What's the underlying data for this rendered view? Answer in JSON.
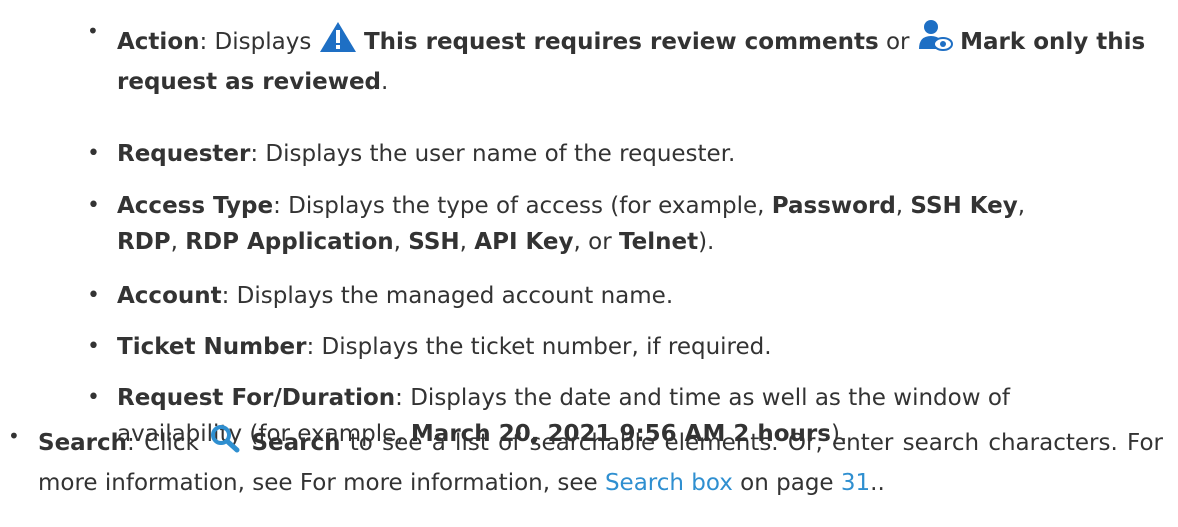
{
  "items": {
    "action": {
      "term": "Action",
      "sep": ": Displays ",
      "warning_text": "This request requires review comments",
      "or": " or ",
      "mark_text": "Mark only this request as reviewed",
      "end": ".",
      "warning_icon": "warning-triangle-icon",
      "mark_icon": "user-reviewed-icon"
    },
    "requester": {
      "term": "Requester",
      "desc": ": Displays the user name of the requester."
    },
    "access_type": {
      "term": "Access Type",
      "desc1": ": Displays the type of access (for example, ",
      "password": "Password",
      "c1": ", ",
      "ssh_key": "SSH Key",
      "c2": ",",
      "rdp": "RDP",
      "c3": ", ",
      "rdp_app": "RDP Application",
      "c4": ", ",
      "ssh": "SSH",
      "c5": ", ",
      "api_key": "API Key",
      "c6": ", or ",
      "telnet": "Telnet",
      "end": ")."
    },
    "account": {
      "term": "Account",
      "desc": ": Displays the managed account name."
    },
    "ticket": {
      "term": "Ticket Number",
      "desc": ": Displays the ticket number, if required."
    },
    "request_for": {
      "term": "Request For/Duration",
      "desc1": ": Displays the date and time as well as the window of availability (for example, ",
      "example": "March 20, 2021 9:56 AM 2 hours",
      "end": ")."
    },
    "search": {
      "term": "Search",
      "desc1": ": Click ",
      "search_label": "Search",
      "desc2": " to see a list of searchable elements. Or, enter search characters. For more information, see For more information, see ",
      "link_text": "Search box",
      "on_page": " on page ",
      "page_num": "31",
      "end": "..",
      "search_icon": "magnifier-icon"
    }
  },
  "colors": {
    "text": "#333333",
    "link": "#2f8fd0",
    "warning": "#1e6fc4"
  }
}
